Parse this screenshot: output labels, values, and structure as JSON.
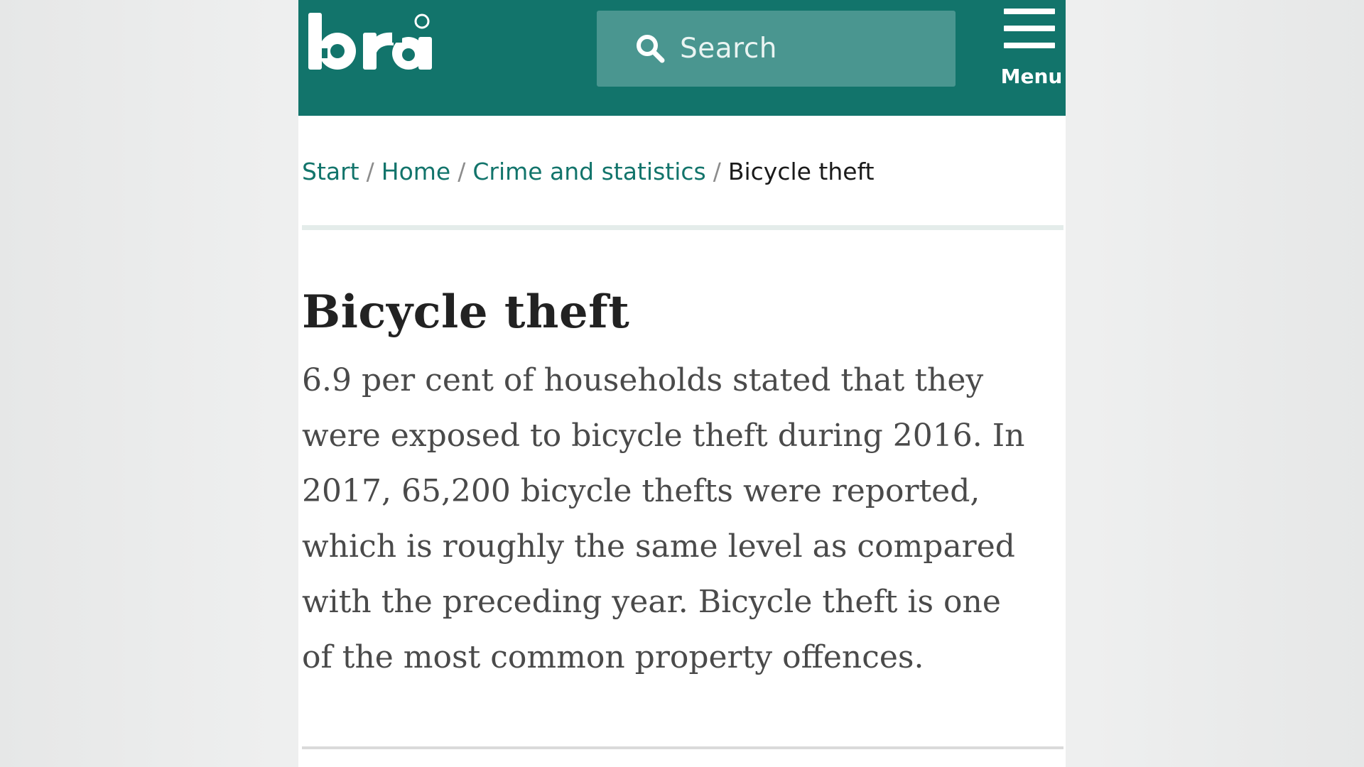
{
  "header": {
    "logo_text": "brå",
    "search": {
      "label": "Search",
      "icon": "search-icon"
    },
    "menu": {
      "label": "Menu",
      "icon": "hamburger-icon"
    },
    "background_color": "#12746b"
  },
  "breadcrumb": {
    "items": [
      {
        "label": "Start"
      },
      {
        "label": "Home"
      },
      {
        "label": "Crime and statistics"
      }
    ],
    "separator": "/",
    "current": "Bicycle theft"
  },
  "article": {
    "title": "Bicycle theft",
    "lead_lines": [
      "6.9 per cent of households stated that they",
      "were exposed to bicycle theft during 2016. In",
      "2017, 65,200 bicycle thefts were reported,",
      "which is roughly the same level as compared",
      "with the preceding year. Bicycle theft is one",
      "of the most common property offences."
    ]
  }
}
